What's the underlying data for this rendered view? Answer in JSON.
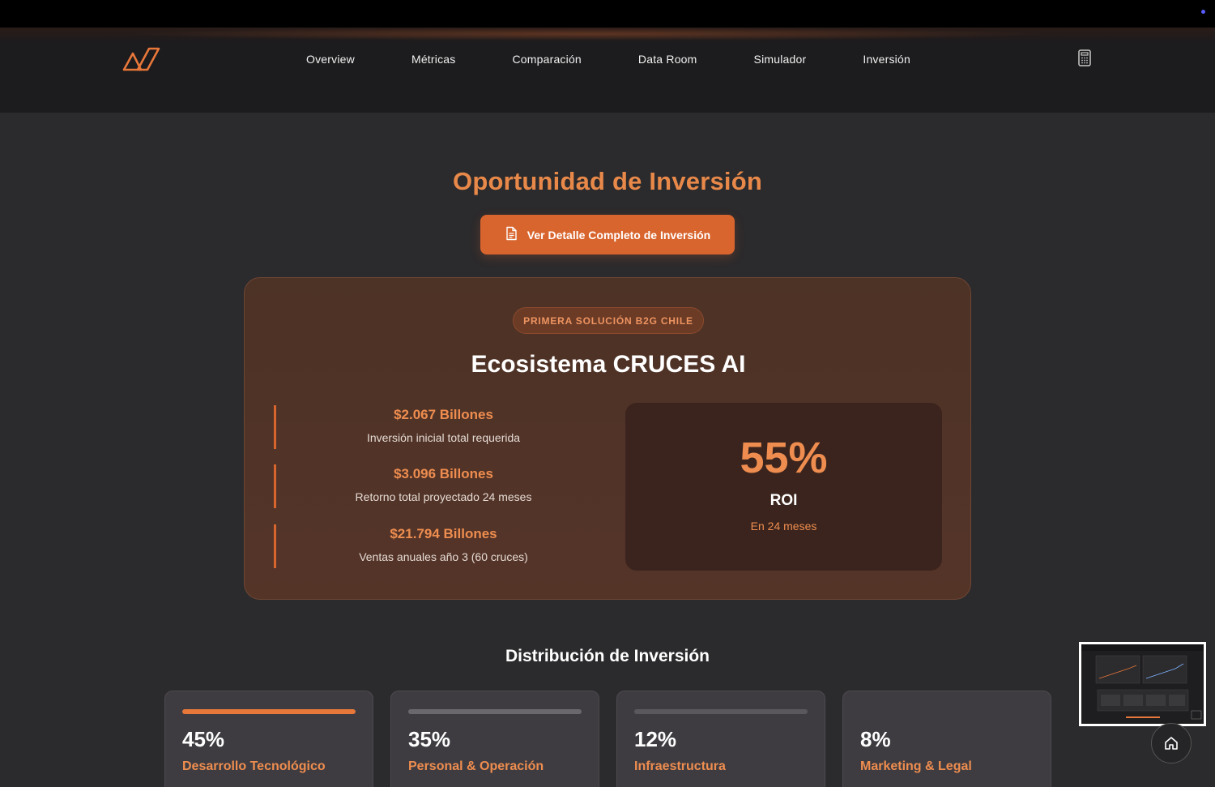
{
  "nav": {
    "links": [
      "Overview",
      "Métricas",
      "Comparación",
      "Data Room",
      "Simulador",
      "Inversión"
    ],
    "logo_icon": "brand-logo-icon",
    "calculator_icon": "calculator-icon"
  },
  "hero": {
    "title": "Oportunidad de Inversión",
    "detail_button_label": "Ver Detalle Completo de Inversión",
    "detail_button_icon": "document-icon"
  },
  "ecosystem": {
    "badge": "PRIMERA SOLUCIÓN B2G CHILE",
    "title": "Ecosistema CRUCES AI",
    "metrics": [
      {
        "value": "$2.067 Billones",
        "label": "Inversión inicial total requerida"
      },
      {
        "value": "$3.096 Billones",
        "label": "Retorno total proyectado 24 meses"
      },
      {
        "value": "$21.794 Billones",
        "label": "Ventas anuales año 3 (60 cruces)"
      }
    ],
    "roi": {
      "percent": "55%",
      "label": "ROI",
      "sub": "En 24 meses"
    }
  },
  "distribution": {
    "title": "Distribución de Inversión",
    "cards": [
      {
        "percent": "45%",
        "category": "Desarrollo Tecnológico",
        "fraction": 1.0,
        "accent": "#e8773a"
      },
      {
        "percent": "35%",
        "category": "Personal & Operación",
        "fraction": 1.0,
        "accent": "#6a686c"
      },
      {
        "percent": "12%",
        "category": "Infraestructura",
        "fraction": 1.0,
        "accent": "#5a585c"
      },
      {
        "percent": "8%",
        "category": "Marketing & Legal",
        "fraction": 0,
        "accent": "#5a585c"
      }
    ]
  },
  "floating": {
    "home_icon": "home-icon",
    "thumbnail": "page-thumbnail-preview"
  },
  "colors": {
    "accent": "#d9652e",
    "accent_text": "#ee8d4f",
    "background": "#2b2a2c"
  }
}
